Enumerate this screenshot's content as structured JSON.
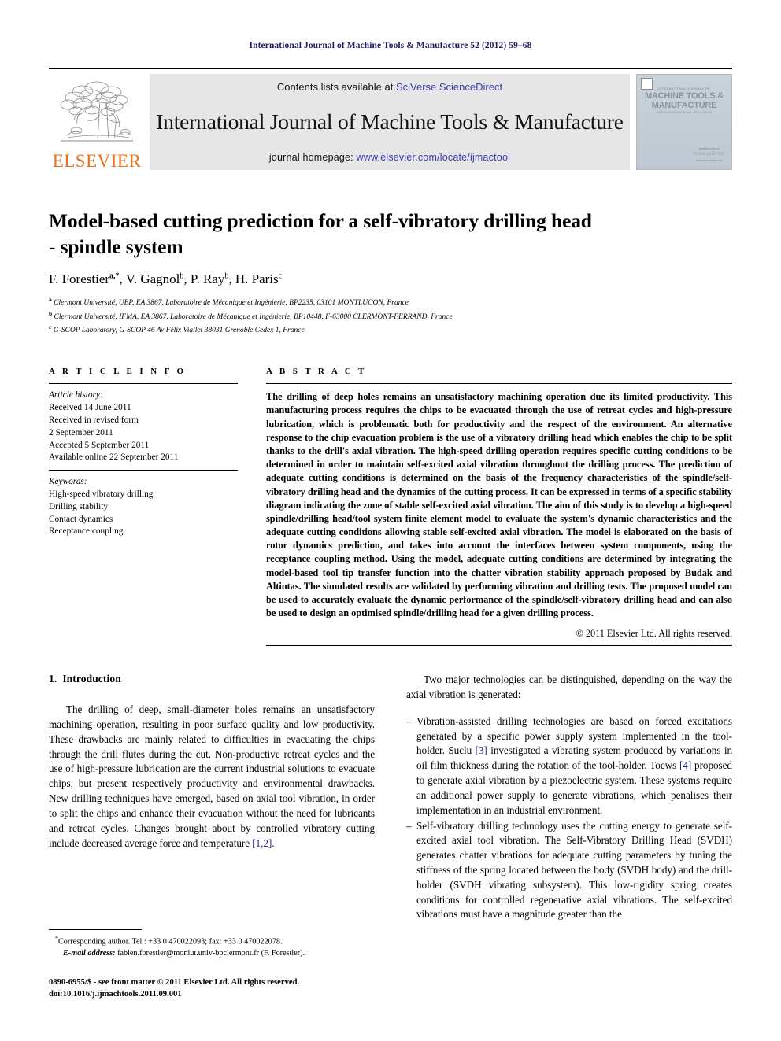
{
  "running_head": "International Journal of Machine Tools & Manufacture 52 (2012) 59–68",
  "masthead": {
    "publisher_name": "ELSEVIER",
    "contents_prefix": "Contents lists available at ",
    "contents_link": "SciVerse ScienceDirect",
    "journal_title": "International Journal of Machine Tools & Manufacture",
    "homepage_prefix": "journal homepage: ",
    "homepage_url": "www.elsevier.com/locate/ijmactool",
    "cover": {
      "eyebrow": "INTERNATIONAL JOURNAL OF",
      "title": "MACHINE TOOLS & MANUFACTURE",
      "subtitle": "DESIGN, RESEARCH AND APPLICATION",
      "foot_small": "Available online at",
      "foot_big": "ScienceDirect",
      "foot_tiny": "www.sciencedirect.com"
    }
  },
  "article": {
    "title": "Model-based cutting prediction for a self-vibratory drilling head - spindle system",
    "authors": [
      {
        "name": "F. Forestier",
        "marks": "a,*"
      },
      {
        "name": "V. Gagnol",
        "marks": "b"
      },
      {
        "name": "P. Ray",
        "marks": "b"
      },
      {
        "name": "H. Paris",
        "marks": "c"
      }
    ],
    "affiliations": [
      {
        "mark": "a",
        "text": "Clermont Université, UBP, EA 3867, Laboratoire de Mécanique et Ingénierie, BP2235, 03101 MONTLUCON, France"
      },
      {
        "mark": "b",
        "text": "Clermont Université, IFMA, EA 3867, Laboratoire de Mécanique et Ingénierie, BP10448, F-63000 CLERMONT-FERRAND, France"
      },
      {
        "mark": "c",
        "text": "G-SCOP Laboratory, G-SCOP 46 Av Félix Viallet 38031 Grenoble Cedex 1, France"
      }
    ]
  },
  "article_info": {
    "heading": "A R T I C L E  I N F O",
    "history_label": "Article history:",
    "history": [
      "Received 14 June 2011",
      "Received in revised form",
      "2 September 2011",
      "Accepted 5 September 2011",
      "Available online 22 September 2011"
    ],
    "keywords_label": "Keywords:",
    "keywords": [
      "High-speed vibratory drilling",
      "Drilling stability",
      "Contact dynamics",
      "Receptance coupling"
    ]
  },
  "abstract": {
    "heading": "A B S T R A C T",
    "text": "The drilling of deep holes remains an unsatisfactory machining operation due its limited productivity. This manufacturing process requires the chips to be evacuated through the use of retreat cycles and high-pressure lubrication, which is problematic both for productivity and the respect of the environment. An alternative response to the chip evacuation problem is the use of a vibratory drilling head which enables the chip to be split thanks to the drill's axial vibration. The high-speed drilling operation requires specific cutting conditions to be determined in order to maintain self-excited axial vibration throughout the drilling process. The prediction of adequate cutting conditions is determined on the basis of the frequency characteristics of the spindle/self-vibratory drilling head and the dynamics of the cutting process. It can be expressed in terms of a specific stability diagram indicating the zone of stable self-excited axial vibration. The aim of this study is to develop a high-speed spindle/drilling head/tool system finite element model to evaluate the system's dynamic characteristics and the adequate cutting conditions allowing stable self-excited axial vibration. The model is elaborated on the basis of rotor dynamics prediction, and takes into account the interfaces between system components, using the receptance coupling method. Using the model, adequate cutting conditions are determined by integrating the model-based tool tip transfer function into the chatter vibration stability approach proposed by Budak and Altintas. The simulated results are validated by performing vibration and drilling tests. The proposed model can be used to accurately evaluate the dynamic performance of the spindle/self-vibratory drilling head and can also be used to design an optimised spindle/drilling head for a given drilling process.",
    "copyright": "© 2011 Elsevier Ltd. All rights reserved."
  },
  "introduction": {
    "number": "1.",
    "title": "Introduction",
    "left_paragraph_1": "The drilling of deep, small-diameter holes remains an unsatisfactory machining operation, resulting in poor surface quality and low productivity. These drawbacks are mainly related to difficulties in evacuating the chips through the drill flutes during the cut. Non-productive retreat cycles and the use of high-pressure lubrication are the current industrial solutions to evacuate chips, but present respectively productivity and environmental drawbacks. New drilling techniques have emerged, based on axial tool vibration, in order to split the chips and enhance their evacuation without the need for lubricants and retreat cycles. Changes brought about by controlled vibratory cutting include decreased average force and temperature ",
    "left_paragraph_1_ref": "[1,2]",
    "left_paragraph_1_end": ".",
    "right_paragraph_1": "Two major technologies can be distinguished, depending on the way the axial vibration is generated:",
    "bullets": [
      {
        "part1": "Vibration-assisted drilling technologies are based on forced excitations generated by a specific power supply system implemented in the tool-holder. Suclu ",
        "ref1": "[3]",
        "part2": " investigated a vibrating system produced by variations in oil film thickness during the rotation of the tool-holder. Toews ",
        "ref2": "[4]",
        "part3": " proposed to generate axial vibration by a piezoelectric system. These systems require an additional power supply to generate vibrations, which penalises their implementation in an industrial environment."
      },
      {
        "part1": "Self-vibratory drilling technology uses the cutting energy to generate self-excited axial tool vibration. The Self-Vibratory Drilling Head (SVDH) generates chatter vibrations for adequate cutting parameters by tuning the stiffness of the spring located between the body (SVDH body) and the drill-holder (SVDH vibrating subsystem). This low-rigidity spring creates conditions for controlled regenerative axial vibrations. The self-excited vibrations must have a magnitude greater than the",
        "ref1": "",
        "part2": "",
        "ref2": "",
        "part3": ""
      }
    ]
  },
  "footnote": {
    "marker": "*",
    "line1": "Corresponding author. Tel.: +33 0 470022093; fax: +33 0 470022078.",
    "email_label": "E-mail address:",
    "email": "fabien.forestier@moniut.univ-bpclermont.fr (F. Forestier)."
  },
  "footer": {
    "issn_line": "0890-6955/$ - see front matter © 2011 Elsevier Ltd. All rights reserved.",
    "doi_line": "doi:10.1016/j.ijmachtools.2011.09.001"
  },
  "colors": {
    "running_head": "#1a1a5e",
    "link": "#3b3bb0",
    "elsevier_orange": "#E9711C",
    "reference": "#23238e"
  }
}
